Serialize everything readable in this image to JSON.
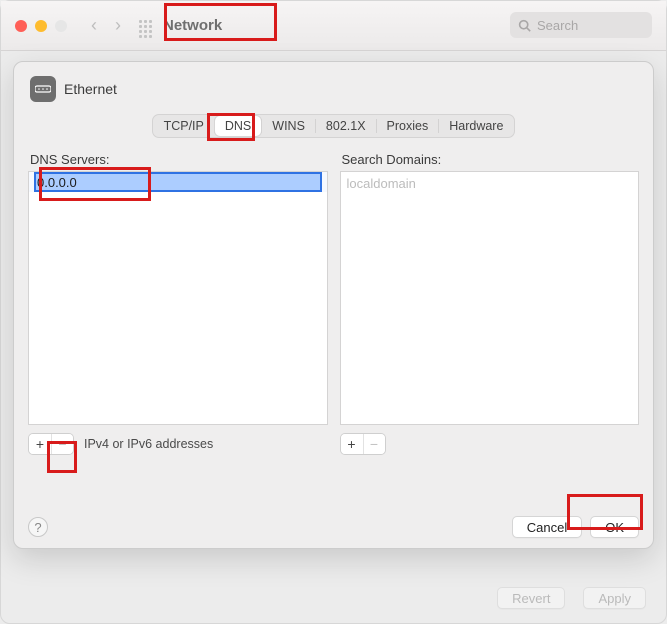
{
  "window": {
    "title": "Network"
  },
  "search": {
    "placeholder": "Search"
  },
  "interface": {
    "name": "Ethernet"
  },
  "tabs": {
    "tcpip": "TCP/IP",
    "dns": "DNS",
    "wins": "WINS",
    "dot1x": "802.1X",
    "proxies": "Proxies",
    "hardware": "Hardware",
    "selected": "DNS"
  },
  "dns": {
    "label": "DNS Servers:",
    "entry_value": "0.0.0.0",
    "hint": "IPv4 or IPv6 addresses"
  },
  "domains": {
    "label": "Search Domains:",
    "placeholder": "localdomain"
  },
  "buttons": {
    "plus": "+",
    "minus": "−",
    "cancel": "Cancel",
    "ok": "OK",
    "help": "?",
    "revert": "Revert",
    "apply": "Apply"
  }
}
